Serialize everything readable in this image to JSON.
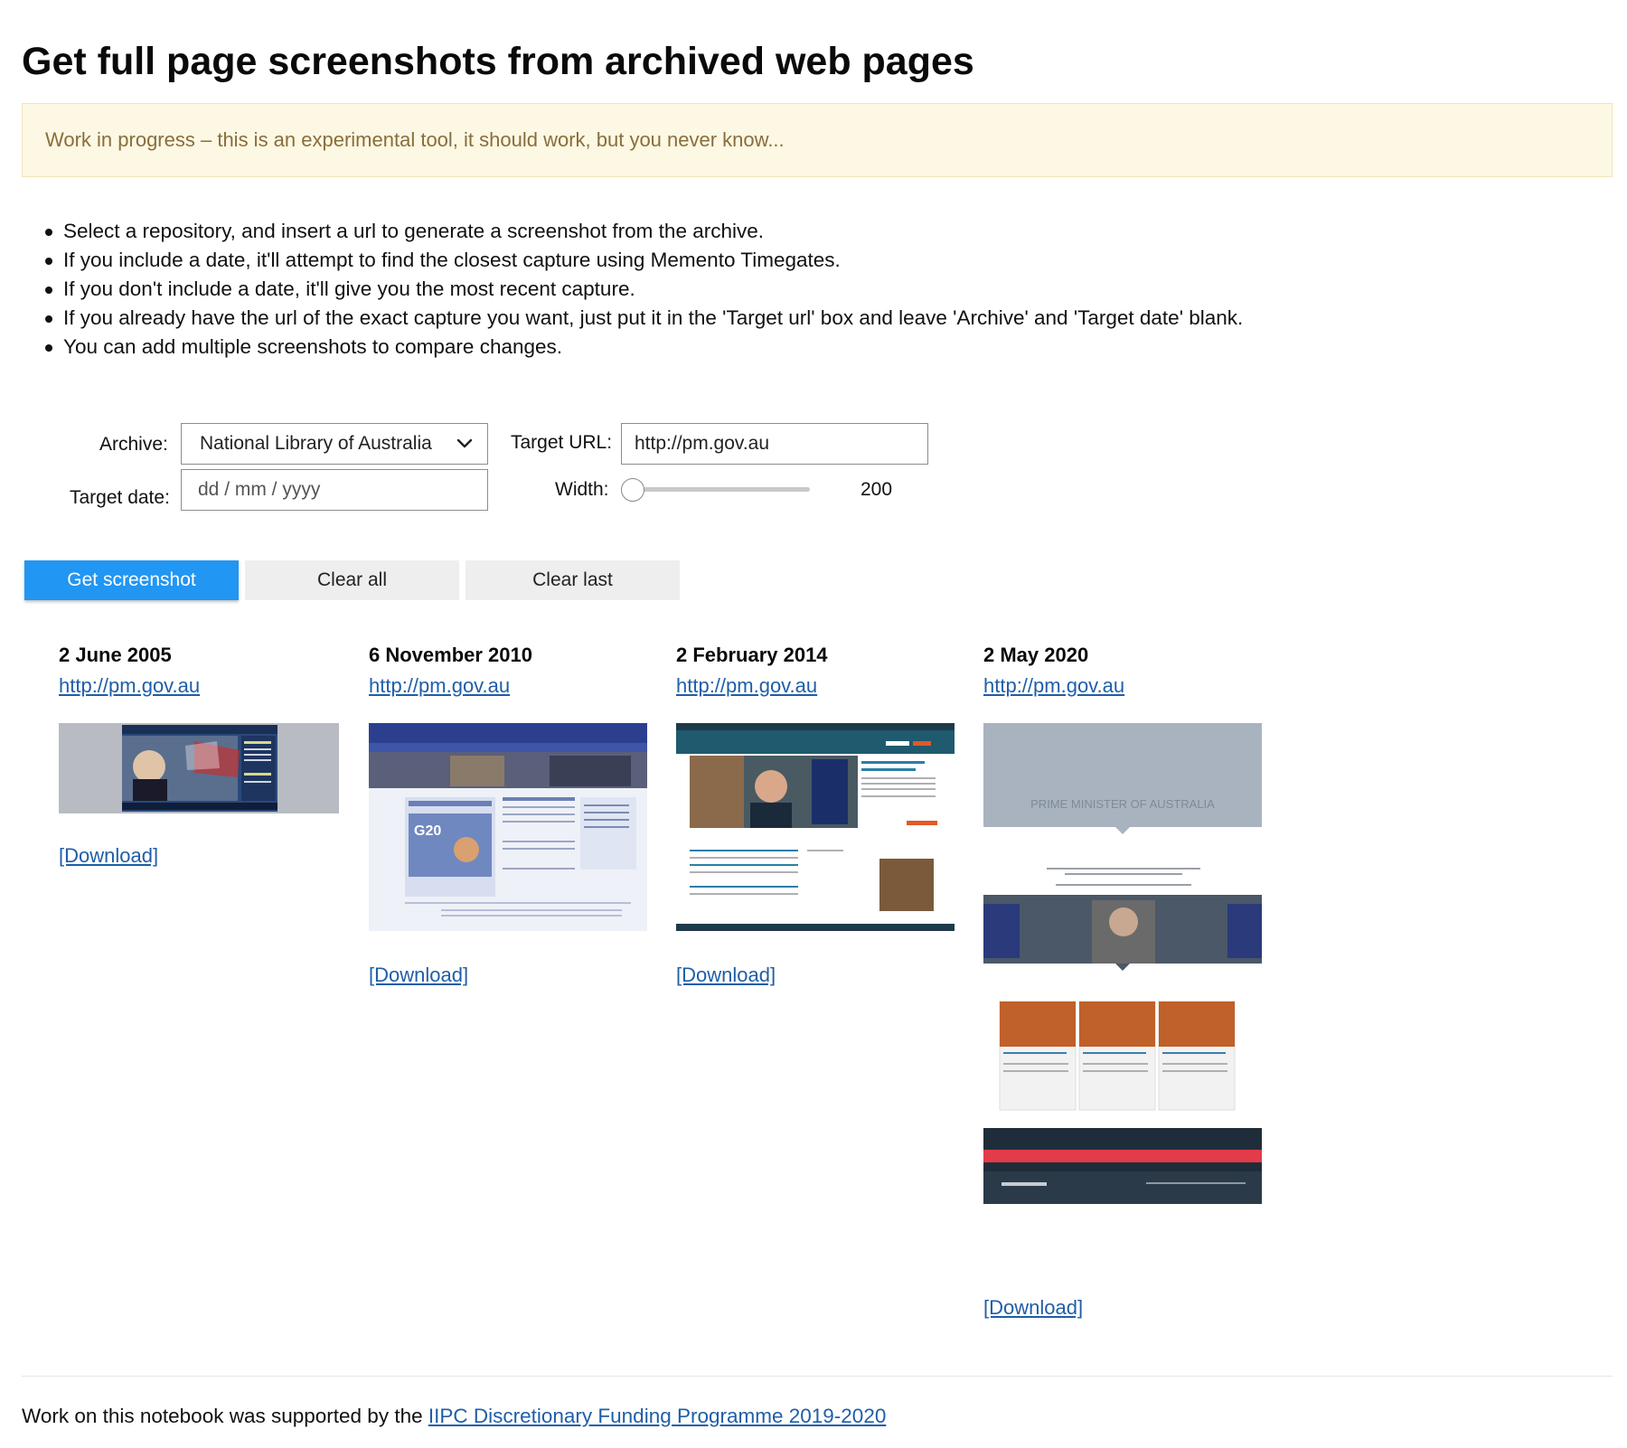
{
  "page": {
    "title": "Get full page screenshots from archived web pages",
    "alert": "Work in progress – this is an experimental tool, it should work, but you never know..."
  },
  "instructions": [
    "Select a repository, and insert a url to generate a screenshot from the archive.",
    "If you include a date, it'll attempt to find the closest capture using Memento Timegates.",
    "If you don't include a date, it'll give you the most recent capture.",
    "If you already have the url of the exact capture you want, just put it in the 'Target url' box and leave 'Archive' and 'Target date' blank.",
    "You can add multiple screenshots to compare changes."
  ],
  "form": {
    "archive_label": "Archive:",
    "archive_value": "National Library of Australia",
    "target_date_label": "Target date:",
    "target_date_placeholder": "dd / mm / yyyy",
    "target_url_label": "Target URL:",
    "target_url_value": "http://pm.gov.au",
    "width_label": "Width:",
    "width_value": "200"
  },
  "buttons": {
    "get_screenshot": "Get screenshot",
    "clear_all": "Clear all",
    "clear_last": "Clear last"
  },
  "screenshots": [
    {
      "date": "2 June 2005",
      "url": "http://pm.gov.au",
      "download": "[Download]"
    },
    {
      "date": "6 November 2010",
      "url": "http://pm.gov.au",
      "download": "[Download]"
    },
    {
      "date": "2 February 2014",
      "url": "http://pm.gov.au",
      "download": "[Download]"
    },
    {
      "date": "2 May 2020",
      "url": "http://pm.gov.au",
      "download": "[Download]"
    }
  ],
  "footer": {
    "text": "Work on this notebook was supported by the ",
    "link": "IIPC Discretionary Funding Programme 2019-2020"
  },
  "thumbnail_text": {
    "shot4_heading": "PRIME MINISTER OF AUSTRALIA"
  },
  "colors": {
    "primary_button": "#2196f3",
    "link": "#1f5ea8",
    "alert_bg": "#fcf8e3",
    "alert_text": "#8a6d3b"
  }
}
